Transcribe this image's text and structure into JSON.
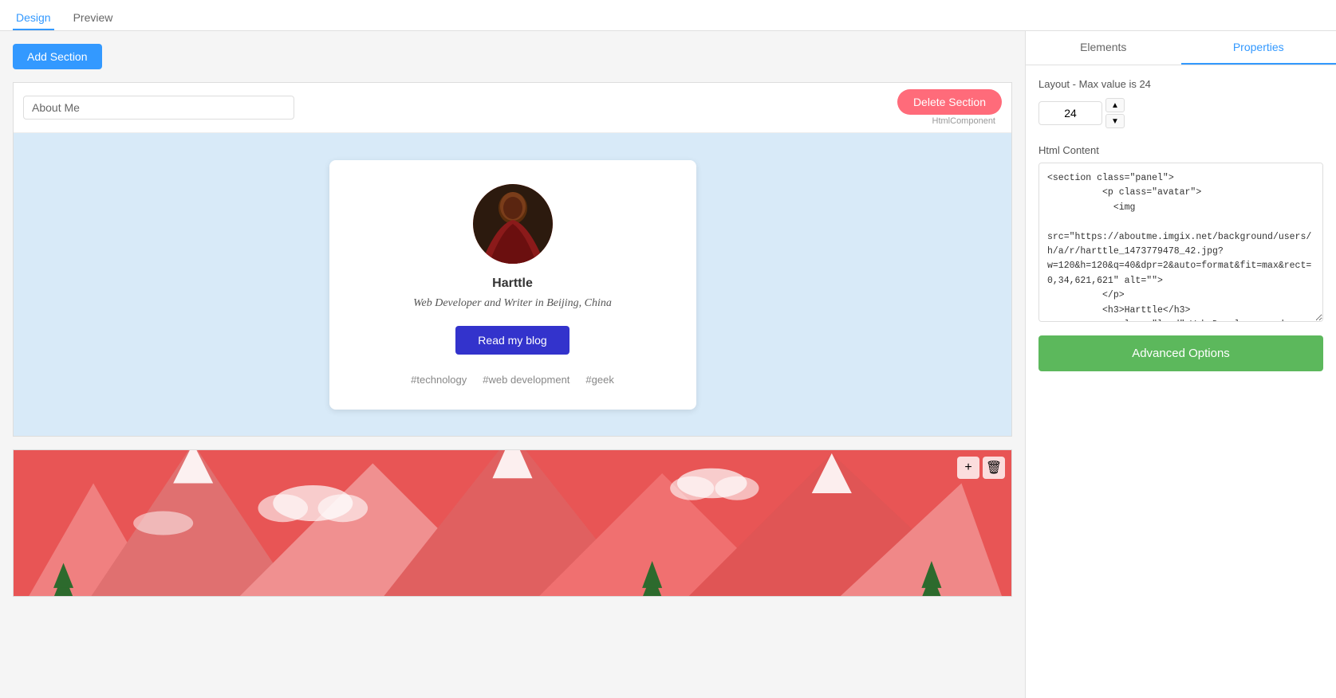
{
  "tabs": {
    "design": "Design",
    "preview": "Preview"
  },
  "active_tab": "Design",
  "add_section_button": "Add Section",
  "section_about": {
    "title_input_value": "About Me",
    "title_input_placeholder": "About Me",
    "delete_button": "Delete Section",
    "component_label": "HtmlComponent",
    "person_name": "Harttle",
    "person_title": "Web Developer and Writer in Beijing, China",
    "read_blog_button": "Read my blog",
    "tags": [
      "#technology",
      "#web development",
      "#geek"
    ]
  },
  "right_panel": {
    "tab_elements": "Elements",
    "tab_properties": "Properties",
    "active_tab": "Properties",
    "layout_label": "Layout - Max value is 24",
    "layout_value": "24",
    "html_content_label": "Html Content",
    "code_content": "<section class=\"panel\">\n          <p class=\"avatar\">\n            <img\n src=\"https://aboutme.imgix.net/background/users/h/a/r/harttle_1473779478_42.jpg?w=120&h=120&q=40&dpr=2&auto=format&fit=max&rect=0,34,621,621\" alt=\"\">\n          </p>\n          <h3>Harttle</h3>\n          <p class=\"lead\">Web Developer and",
    "advanced_options_button": "Advanced Options"
  }
}
